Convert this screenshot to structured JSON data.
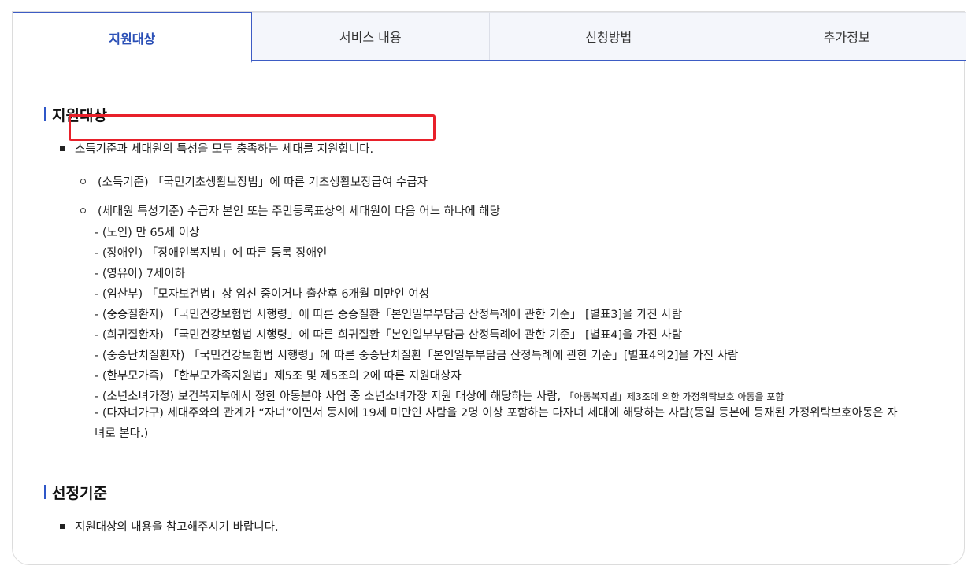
{
  "tabs": [
    {
      "label": "지원대상",
      "active": true
    },
    {
      "label": "서비스 내용",
      "active": false
    },
    {
      "label": "신청방법",
      "active": false
    },
    {
      "label": "추가정보",
      "active": false
    }
  ],
  "section1": {
    "title": "지원대상",
    "intro": "소득기준과 세대원의 특성을 모두 충족하는 세대를 지원합니다.",
    "income_criterion": "(소득기준) 「국민기초생활보장법」에 따른 기초생활보장급여 수급자",
    "household_criterion": "(세대원 특성기준) 수급자 본인 또는 주민등록표상의 세대원이 다음 어느 하나에 해당",
    "items": [
      "- (노인) 만 65세 이상",
      "- (장애인) 「장애인복지법」에 따른 등록 장애인",
      "- (영유아) 7세이하",
      "- (임산부) 「모자보건법」상 임신 중이거나 출산후 6개월 미만인 여성",
      "- (중증질환자) 「국민건강보험법 시행령」에 따른 중증질환「본인일부부담금 산정특례에 관한 기준」 [별표3]을 가진 사람",
      "- (희귀질환자) 「국민건강보험법 시행령」에 따른 희귀질환「본인일부부담금 산정특례에 관한 기준」 [별표4]을 가진 사람",
      "- (중증난치질환자) 「국민건강보험법 시행령」에 따른 중증난치질환「본인일부부담금 산정특례에 관한 기준」[별표4의2]을 가진 사람",
      "- (한부모가족) 「한부모가족지원법」제5조 및 제5조의 2에 따른 지원대상자"
    ],
    "youth_item": "- (소년소녀가정) 보건복지부에서 정한 아동분야 사업 중 소년소녀가장 지원 대상에 해당하는 사람,",
    "youth_note": "「아동복지법」제3조에 의한 가정위탁보호 아동을 포함",
    "multichild_item": "- (다자녀가구) 세대주와의 관계가 “자녀”이면서 동시에 19세 미만인 사람을 2명 이상 포함하는 다자녀 세대에 해당하는 사람(동일 등본에 등재된 가정위탁보호아동은 자녀로 본다.)"
  },
  "section2": {
    "title": "선정기준",
    "intro": "지원대상의 내용을 참고해주시기 바랍니다."
  },
  "colors": {
    "accent": "#3d5cc4",
    "highlight": "#e8202a"
  }
}
